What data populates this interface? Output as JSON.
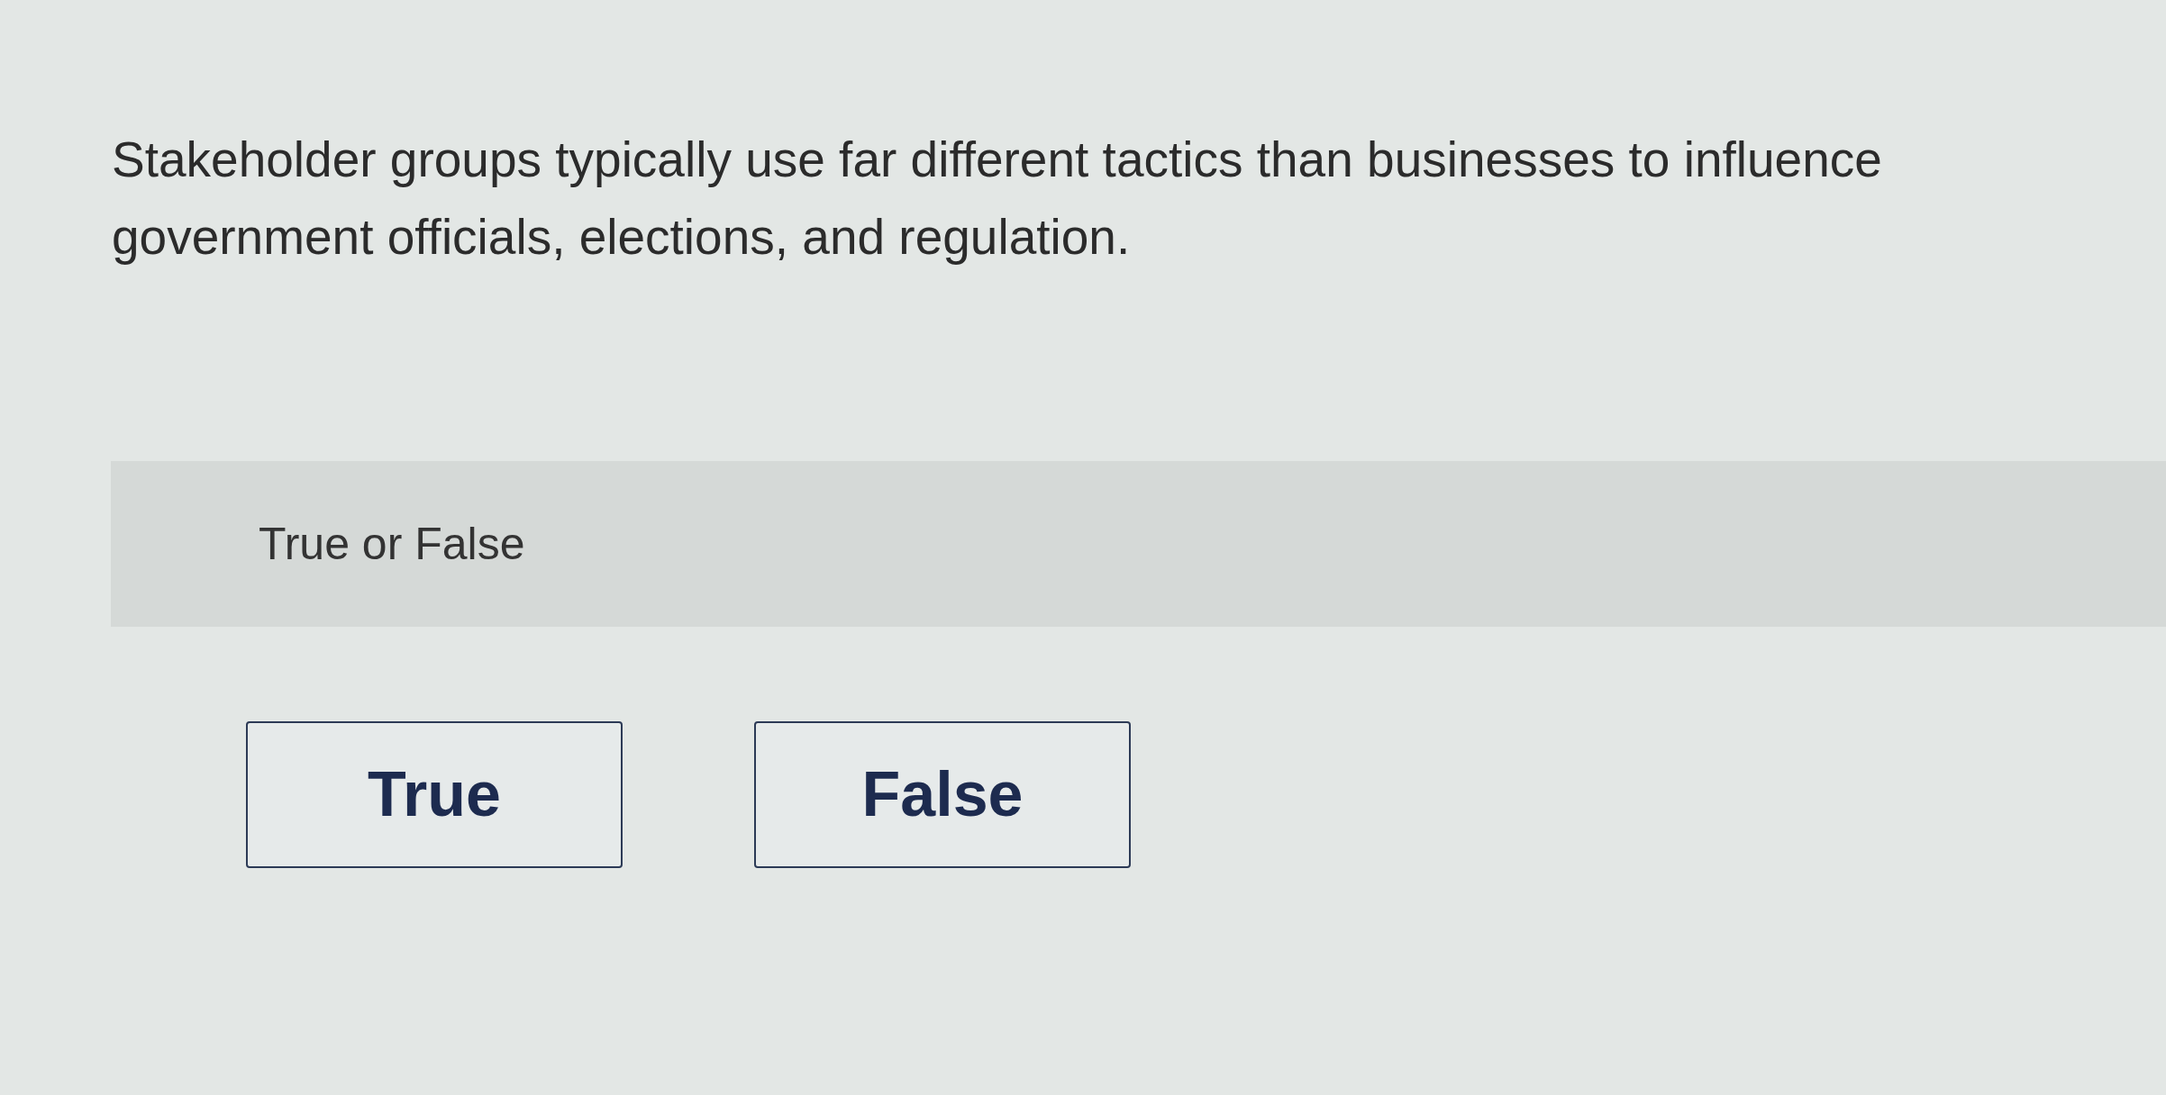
{
  "question": {
    "text": "Stakeholder groups typically use far different tactics than businesses to influence government officials, elections, and regulation."
  },
  "prompt": {
    "label": "True or False"
  },
  "options": [
    {
      "label": "True",
      "selected": false
    },
    {
      "label": "False",
      "selected": false
    }
  ]
}
